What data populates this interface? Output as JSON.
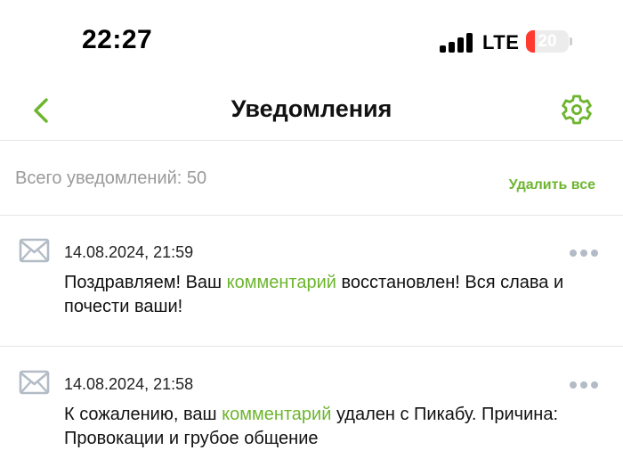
{
  "status_bar": {
    "time": "22:27",
    "network": "LTE",
    "battery": "20",
    "battery_level": 0.2,
    "signal_bars": 4
  },
  "nav": {
    "title": "Уведомления",
    "back_icon": "chevron-left-icon",
    "settings_icon": "gear-icon"
  },
  "summary": {
    "total": "Всего уведомлений: 50",
    "delete_all": "Удалить все"
  },
  "notifications": [
    {
      "icon": "mail-icon",
      "date": "14.08.2024, 21:59",
      "text_before": "Поздравляем! Ваш ",
      "link": "комментарий",
      "text_after": " восстановлен! Вся слава и почести ваши!"
    },
    {
      "icon": "mail-icon",
      "date": "14.08.2024, 21:58",
      "text_before": "К сожалению, ваш ",
      "link": "комментарий",
      "text_after": " удален с Пикабу. Причина: Провокации и грубое общение"
    }
  ],
  "colors": {
    "accent": "#6db52e",
    "muted": "#9a9a9a",
    "icon_gray": "#b3bcc6",
    "battery_low": "#ff3b30"
  }
}
